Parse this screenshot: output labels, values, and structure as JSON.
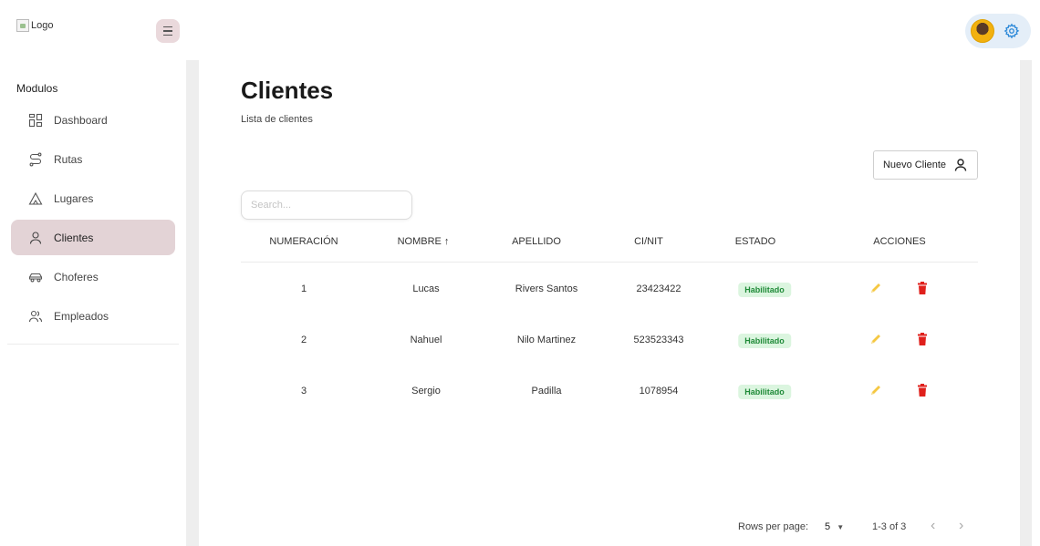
{
  "header": {
    "logo_alt": "Logo",
    "menu_icon": "hamburger-icon",
    "settings_icon": "gear-icon"
  },
  "sidebar": {
    "section_title": "Modulos",
    "items": [
      {
        "label": "Dashboard",
        "icon": "dashboard-icon",
        "active": false
      },
      {
        "label": "Rutas",
        "icon": "route-icon",
        "active": false
      },
      {
        "label": "Lugares",
        "icon": "place-icon",
        "active": false
      },
      {
        "label": "Clientes",
        "icon": "user-icon",
        "active": true
      },
      {
        "label": "Choferes",
        "icon": "car-icon",
        "active": false
      },
      {
        "label": "Empleados",
        "icon": "users-icon",
        "active": false
      }
    ]
  },
  "main": {
    "title": "Clientes",
    "subtitle": "Lista de clientes",
    "new_button": "Nuevo Cliente",
    "search_placeholder": "Search..."
  },
  "table": {
    "columns": [
      "NUMERACIÓN",
      "NOMBRE ↑",
      "APELLIDO",
      "CI/NIT",
      "ESTADO",
      "ACCIONES"
    ],
    "rows": [
      {
        "num": "1",
        "nombre": "Lucas",
        "apellido": "Rivers Santos",
        "ci": "23423422",
        "estado": "Habilitado"
      },
      {
        "num": "2",
        "nombre": "Nahuel",
        "apellido": "Nilo Martinez",
        "ci": "523523343",
        "estado": "Habilitado"
      },
      {
        "num": "3",
        "nombre": "Sergio",
        "apellido": "Padilla",
        "ci": "1078954",
        "estado": "Habilitado"
      }
    ]
  },
  "pagination": {
    "rows_per_page_label": "Rows per page:",
    "rows_per_page_value": "5",
    "range": "1-3 of 3"
  },
  "colors": {
    "active_nav": "#e3d3d6",
    "badge_bg": "#dbf5df",
    "badge_text": "#1f8a38",
    "edit_icon": "#f5c842",
    "delete_icon": "#e0201c",
    "settings_icon": "#2b88d8"
  }
}
